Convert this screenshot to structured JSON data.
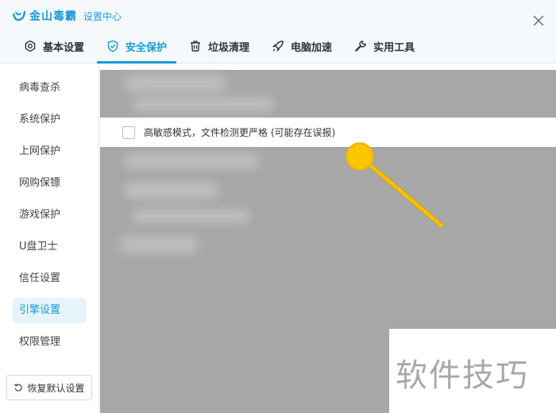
{
  "app": {
    "brand": "金山毒霸",
    "subtitle": "设置中心"
  },
  "tabs": [
    {
      "label": "基本设置",
      "icon": "gear-icon",
      "active": false
    },
    {
      "label": "安全保护",
      "icon": "shield-check-icon",
      "active": true
    },
    {
      "label": "垃圾清理",
      "icon": "trash-icon",
      "active": false
    },
    {
      "label": "电脑加速",
      "icon": "rocket-icon",
      "active": false
    },
    {
      "label": "实用工具",
      "icon": "wrench-icon",
      "active": false
    }
  ],
  "sidebar": {
    "items": [
      {
        "label": "病毒查杀",
        "active": false
      },
      {
        "label": "系统保护",
        "active": false
      },
      {
        "label": "上网保护",
        "active": false
      },
      {
        "label": "网购保镖",
        "active": false
      },
      {
        "label": "游戏保护",
        "active": false
      },
      {
        "label": "U盘卫士",
        "active": false
      },
      {
        "label": "信任设置",
        "active": false
      },
      {
        "label": "引擎设置",
        "active": true
      },
      {
        "label": "权限管理",
        "active": false
      }
    ],
    "reset_label": "恢复默认设置"
  },
  "main": {
    "option": {
      "label": "高敏感模式，文件检测更严格 (可能存在误报)",
      "checked": false
    }
  },
  "watermark": "软件技巧",
  "colors": {
    "accent": "#1a9ad6",
    "annotation": "#f5c100"
  }
}
